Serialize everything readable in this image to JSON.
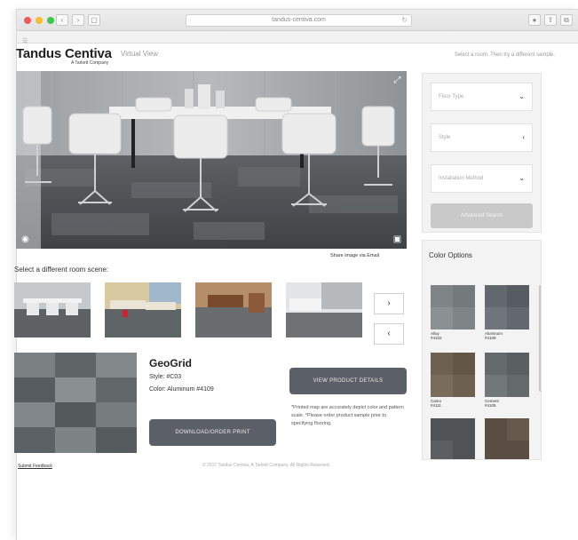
{
  "browser": {
    "url": "tandus-centiva.com"
  },
  "header": {
    "brand": "Tandus Centiva",
    "brand_sub": "A Tarkett Company",
    "virtual_view": "Virtual View",
    "help_link": "Select a room. Then try a different sample."
  },
  "hero": {
    "share_link": "Share image via Email"
  },
  "scenes": {
    "label": "Select a different room scene:"
  },
  "product": {
    "name": "GeoGrid",
    "style": "Style: #C03",
    "color": "Color: Aluminum #4109",
    "view_button": "VIEW PRODUCT DETAILS",
    "download_button": "DOWNLOAD/ORDER PRINT",
    "note": "*Printed map are accurately depict color and pattern scale. *Please order product sample prior to specifying flooring."
  },
  "filters": {
    "floor_type": "Floor Type",
    "style": "Style",
    "installation": "Installation Method",
    "advanced_search": "Advanced Search"
  },
  "color_options": {
    "title": "Color Options",
    "items": [
      {
        "name": "Alloy",
        "code": "#4102",
        "color": "#7f8584"
      },
      {
        "name": "Aluminum",
        "code": "#4109",
        "color": "#62686d"
      },
      {
        "name": "Camo",
        "code": "#4111",
        "color": "#6d6051"
      },
      {
        "name": "Cement",
        "code": "#4105",
        "color": "#646a69"
      },
      {
        "name": "",
        "code": "",
        "color": "#4f5356"
      },
      {
        "name": "",
        "code": "",
        "color": "#5a4e42"
      }
    ]
  },
  "footer": {
    "feedback": "Submit Feedback",
    "copyright": "© 2017 Tandus Centiva, A Tarkett Company. All Rights Reserved."
  }
}
